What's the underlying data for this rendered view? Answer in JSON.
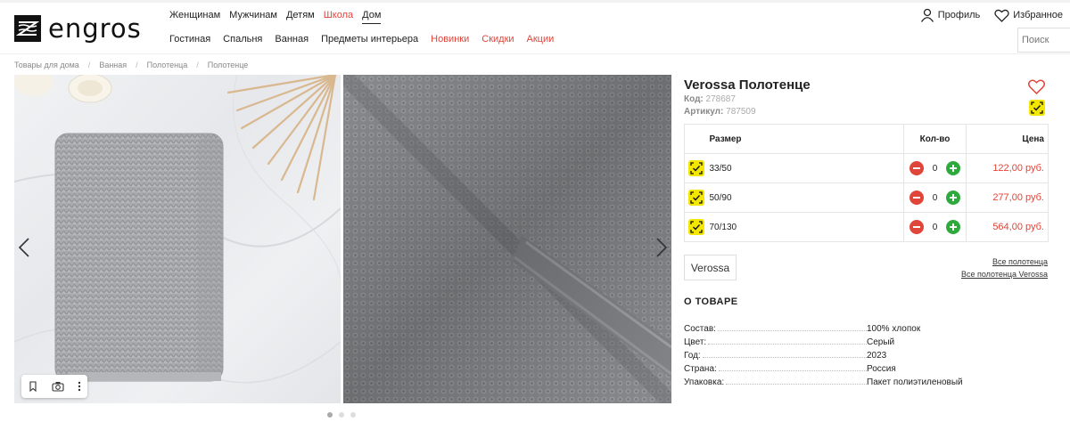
{
  "header": {
    "logo_text": "engros",
    "nav_primary": [
      {
        "label": "Женщинам",
        "style": "normal"
      },
      {
        "label": "Мужчинам",
        "style": "normal"
      },
      {
        "label": "Детям",
        "style": "normal"
      },
      {
        "label": "Школа",
        "style": "red"
      },
      {
        "label": "Дом",
        "style": "active"
      }
    ],
    "nav_secondary": [
      {
        "label": "Гостиная",
        "style": "normal"
      },
      {
        "label": "Спальня",
        "style": "normal"
      },
      {
        "label": "Ванная",
        "style": "normal"
      },
      {
        "label": "Предметы интерьера",
        "style": "normal"
      },
      {
        "label": "Новинки",
        "style": "red"
      },
      {
        "label": "Скидки",
        "style": "red"
      },
      {
        "label": "Акции",
        "style": "red"
      }
    ],
    "profile_label": "Профиль",
    "favorites_label": "Избранное",
    "search_placeholder": "Поиск"
  },
  "breadcrumb": [
    "Товары для дома",
    "Ванная",
    "Полотенца",
    "Полотенце"
  ],
  "gallery": {
    "dot_count": 3,
    "active_dot": 0
  },
  "product": {
    "title": "Verossa Полотенце",
    "code_label": "Код:",
    "code": "278687",
    "article_label": "Артикул:",
    "article": "787509",
    "table_headers": {
      "size": "Размер",
      "qty": "Кол-во",
      "price": "Цена"
    },
    "sizes": [
      {
        "size": "33/50",
        "qty": "0",
        "price": "122,00 руб."
      },
      {
        "size": "50/90",
        "qty": "0",
        "price": "277,00 руб."
      },
      {
        "size": "70/130",
        "qty": "0",
        "price": "564,00 руб."
      }
    ],
    "brand": "Verossa",
    "links": [
      "Все полотенца",
      "Все полотенца Verossa"
    ],
    "about_title": "О ТОВАРЕ",
    "properties": [
      {
        "key": "Состав:",
        "value": "100% хлопок"
      },
      {
        "key": "Цвет:",
        "value": "Серый"
      },
      {
        "key": "Год:",
        "value": "2023"
      },
      {
        "key": "Страна:",
        "value": "Россия"
      },
      {
        "key": "Упаковка:",
        "value": "Пакет полиэтиленовый"
      }
    ]
  },
  "colors": {
    "accent_red": "#e0453a",
    "plus_green": "#2eaa3c",
    "badge_yellow": "#f3e600"
  }
}
